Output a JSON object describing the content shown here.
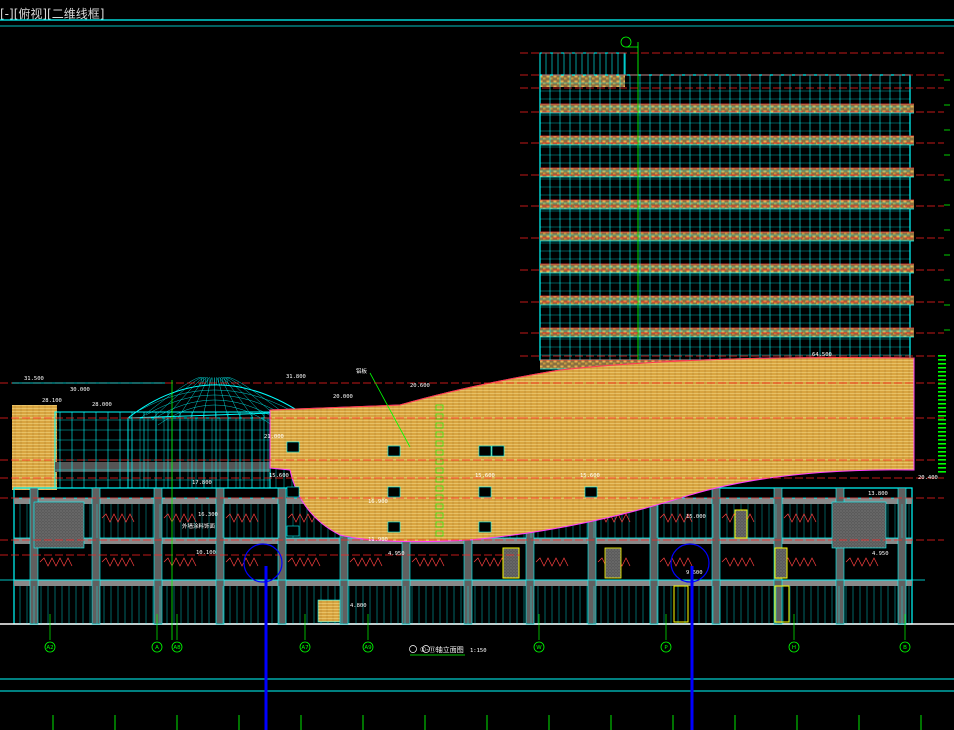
{
  "viewport": {
    "label": "[-][俯视][二维线框]"
  },
  "drawing": {
    "title": "①-⑪轴立面图",
    "scale": "1:150",
    "colors": {
      "background": "#000000",
      "frame": "#00ffff",
      "infill": "#e3b34a",
      "level": "#ff2020",
      "axis": "#00ff00",
      "marker": "#0000ff"
    },
    "axis_labels": [
      "A2",
      "A",
      "A8",
      "A7",
      "A9",
      "W",
      "P",
      "H",
      "B"
    ],
    "dimensions": {
      "roof_tower": "64.500",
      "dome_top": "31.800",
      "curve_top": "30.000",
      "left_parapet": "31.500",
      "left_roof": "28.100",
      "left_roof2": "28.000",
      "mid_roof": "20.000",
      "mid_roof2": "20.600",
      "right_end": "20.400",
      "lvl_17800": "17.800",
      "lvl_16300": "16.300",
      "lvl_15600a": "15.600",
      "lvl_15600b": "15.600",
      "lvl_15600c": "15.600",
      "lvl_13800": "13.800",
      "lvl_21000": "21.000",
      "lvl_4950": "4.950",
      "lvl_4950b": "4.950",
      "lvl_4800": "4.800",
      "lvl_16900": "16.900",
      "lvl_11900": "11.900",
      "lvl_10100": "10.100",
      "lvl_9600": "9.600",
      "lvl_15000": "15.000"
    },
    "notes": {
      "left_note": "外墙涂料饰面",
      "curve_note": "铝板"
    }
  }
}
